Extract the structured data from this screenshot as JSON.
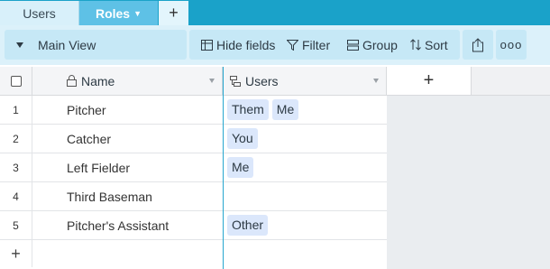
{
  "tabs": [
    {
      "label": "Users",
      "active": false
    },
    {
      "label": "Roles",
      "active": true
    }
  ],
  "tab_add_label": "+",
  "toolbar": {
    "view_name": "Main View",
    "hide_fields_label": "Hide fields",
    "filter_label": "Filter",
    "group_label": "Group",
    "sort_label": "Sort",
    "more_label": "ooo"
  },
  "columns": [
    {
      "label": "Name",
      "icon": "lock-icon"
    },
    {
      "label": "Users",
      "icon": "linked-record-icon"
    }
  ],
  "add_column_label": "+",
  "rows": [
    {
      "num": "1",
      "name": "Pitcher",
      "users": [
        "Them",
        "Me"
      ]
    },
    {
      "num": "2",
      "name": "Catcher",
      "users": [
        "You"
      ]
    },
    {
      "num": "3",
      "name": "Left Fielder",
      "users": [
        "Me"
      ]
    },
    {
      "num": "4",
      "name": "Third Baseman",
      "users": []
    },
    {
      "num": "5",
      "name": "Pitcher's Assistant",
      "users": [
        "Other"
      ]
    }
  ],
  "add_row_label": "+",
  "colors": {
    "tabbar": "#1aa2c9",
    "active_tab": "#5ec1e6",
    "toolbar": "#dcf1fa",
    "chip": "#dbe7fb",
    "column_divider": "#27a7cf"
  }
}
